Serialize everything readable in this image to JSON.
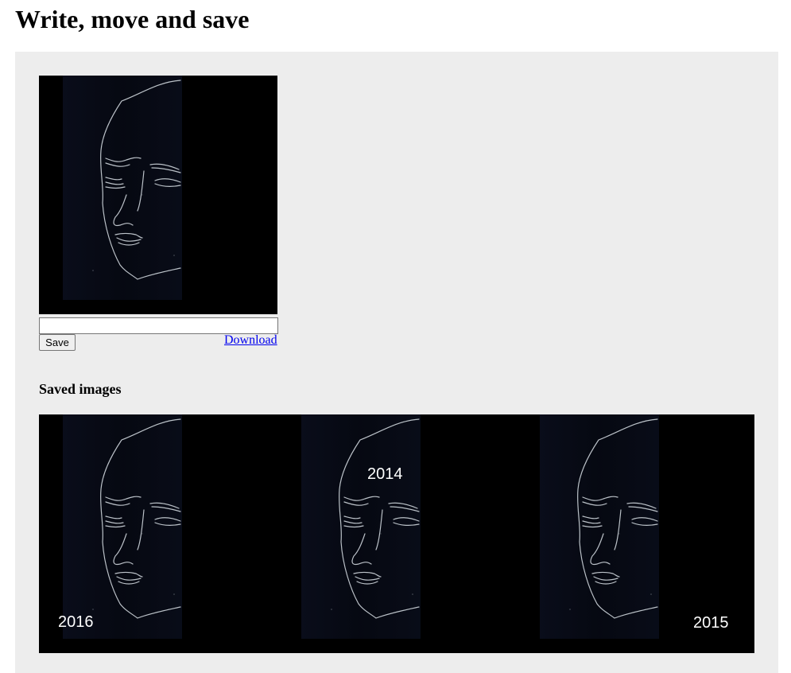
{
  "page": {
    "title": "Write, move and save"
  },
  "editor": {
    "text_value": "",
    "save_label": "Save",
    "download_label": "Download"
  },
  "saved": {
    "heading": "Saved images",
    "images": [
      {
        "caption": "2016"
      },
      {
        "caption": "2014"
      },
      {
        "caption": "2015"
      }
    ]
  }
}
